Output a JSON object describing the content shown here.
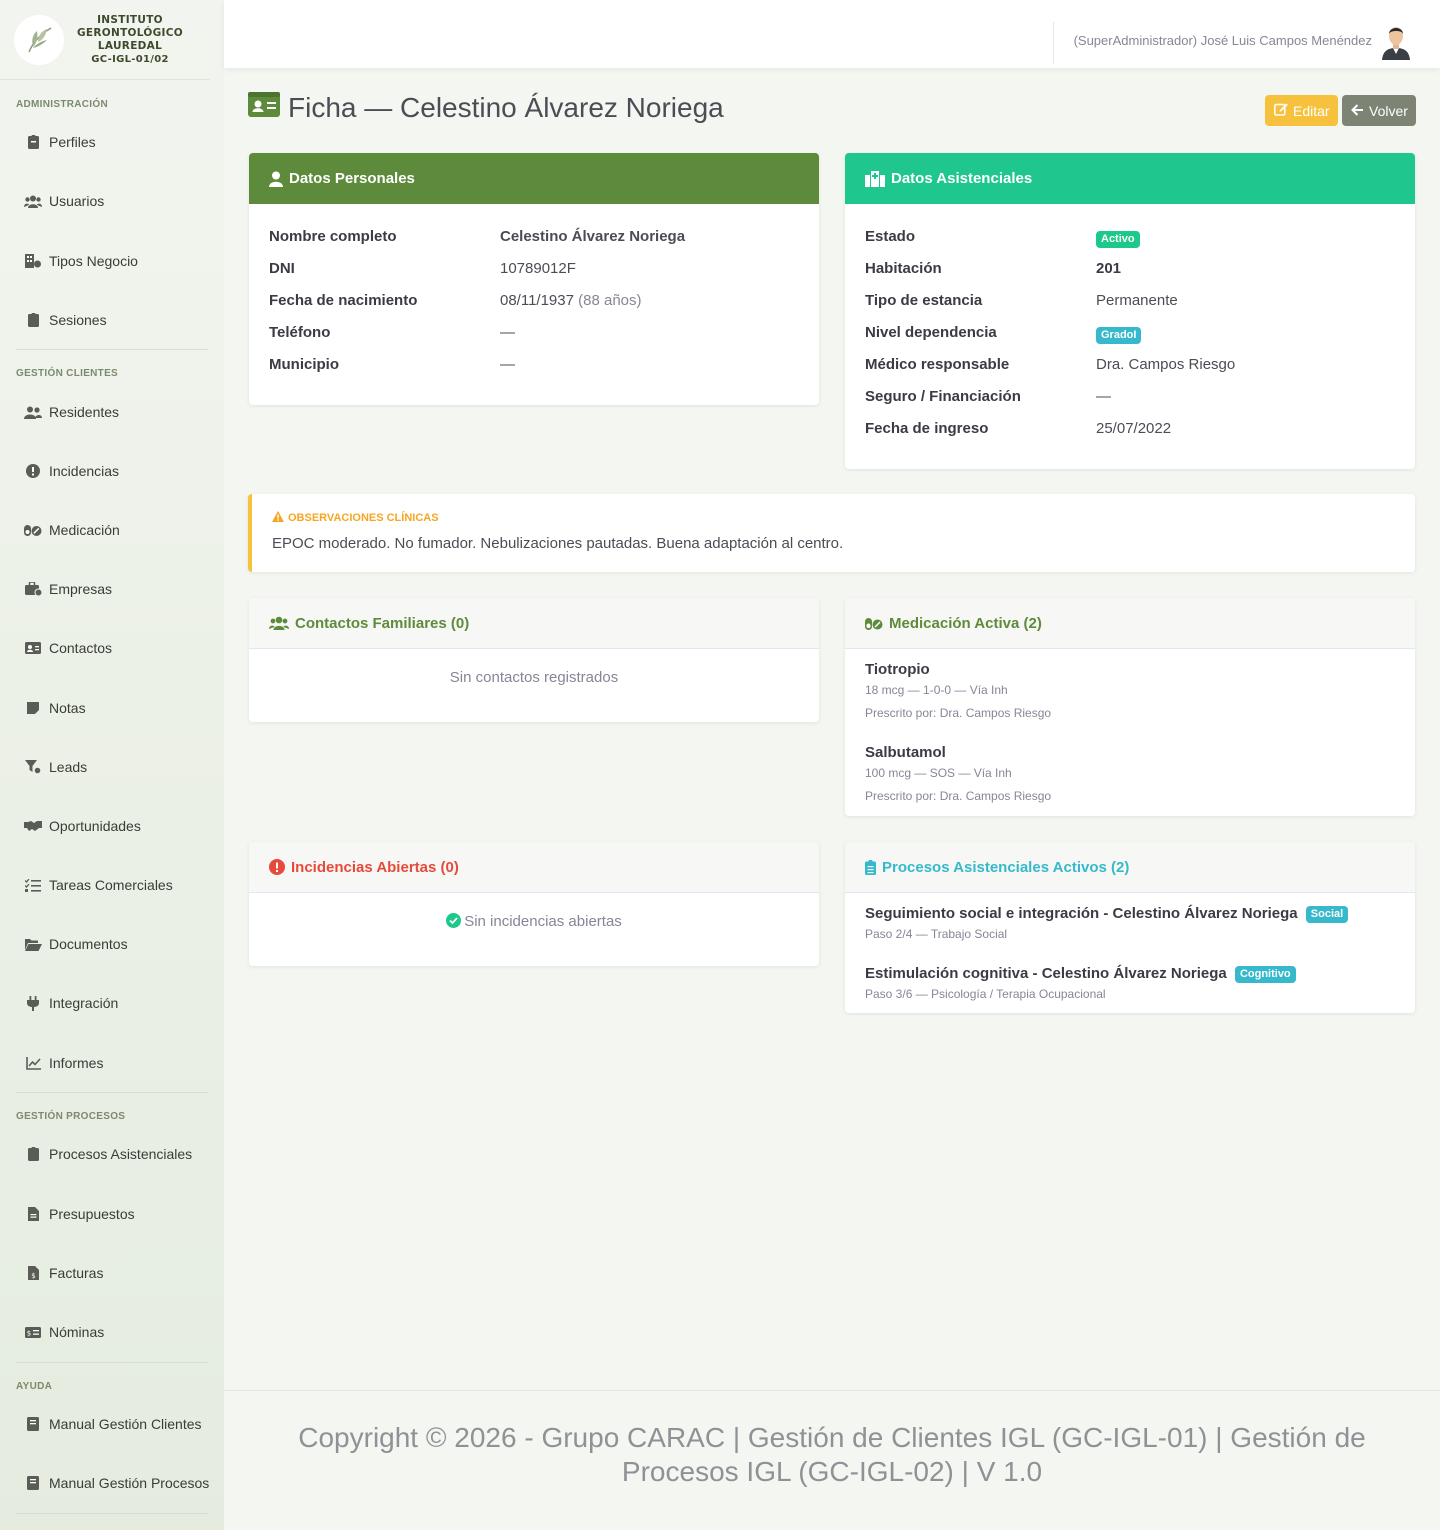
{
  "brand": {
    "line1": "INSTITUTO",
    "line2": "GERONTOLÓGICO",
    "line3": "LAUREDAL",
    "code": "GC-IGL-01/02"
  },
  "sidebar": {
    "sections": {
      "admin": "ADMINISTRACIÓN",
      "clientes": "GESTIÓN CLIENTES",
      "procesos": "GESTIÓN PROCESOS",
      "ayuda": "AYUDA"
    },
    "items": {
      "perfiles": "Perfiles",
      "usuarios": "Usuarios",
      "tipos_negocio": "Tipos Negocio",
      "sesiones": "Sesiones",
      "residentes": "Residentes",
      "incidencias": "Incidencias",
      "medicacion": "Medicación",
      "empresas": "Empresas",
      "contactos": "Contactos",
      "notas": "Notas",
      "leads": "Leads",
      "oportunidades": "Oportunidades",
      "tareas": "Tareas Comerciales",
      "documentos": "Documentos",
      "integracion": "Integración",
      "informes": "Informes",
      "procesos_asistenciales": "Procesos Asistenciales",
      "presupuestos": "Presupuestos",
      "facturas": "Facturas",
      "nominas": "Nóminas",
      "manual_clientes": "Manual Gestión Clientes",
      "manual_procesos": "Manual Gestión Procesos"
    }
  },
  "topbar": {
    "user": "(SuperAdministrador) José Luis Campos Menéndez"
  },
  "page": {
    "title": "Ficha — Celestino Álvarez Noriega",
    "edit_label": "Editar",
    "back_label": "Volver"
  },
  "personal": {
    "title": "Datos Personales",
    "fields": [
      {
        "label": "Nombre completo",
        "value": "Celestino Álvarez Noriega"
      },
      {
        "label": "DNI",
        "value": "10789012F"
      },
      {
        "label": "Fecha de nacimiento",
        "value": "08/11/1937",
        "extra": "(88 años)"
      },
      {
        "label": "Teléfono",
        "value": "—"
      },
      {
        "label": "Municipio",
        "value": "—"
      }
    ]
  },
  "asistencial": {
    "title": "Datos Asistenciales",
    "fields": [
      {
        "label": "Estado",
        "value": "Activo"
      },
      {
        "label": "Habitación",
        "value": "201"
      },
      {
        "label": "Tipo de estancia",
        "value": "Permanente"
      },
      {
        "label": "Nivel dependencia",
        "value": "GradoI"
      },
      {
        "label": "Médico responsable",
        "value": "Dra. Campos Riesgo"
      },
      {
        "label": "Seguro / Financiación",
        "value": "—"
      },
      {
        "label": "Fecha de ingreso",
        "value": "25/07/2022"
      }
    ]
  },
  "observaciones": {
    "title": "OBSERVACIONES CLÍNICAS",
    "text": "EPOC moderado. No fumador. Nebulizaciones pautadas. Buena adaptación al centro."
  },
  "contactos": {
    "title": "Contactos Familiares (0)",
    "empty": "Sin contactos registrados"
  },
  "medicacion": {
    "title": "Medicación Activa (2)",
    "items": [
      {
        "name": "Tiotropio",
        "detail": "18 mcg — 1-0-0 — Vía Inh",
        "prescriber": "Prescrito por: Dra. Campos Riesgo"
      },
      {
        "name": "Salbutamol",
        "detail": "100 mcg — SOS — Vía Inh",
        "prescriber": "Prescrito por: Dra. Campos Riesgo"
      }
    ]
  },
  "incidencias": {
    "title": "Incidencias Abiertas (0)",
    "empty": "Sin incidencias abiertas"
  },
  "procesos": {
    "title": "Procesos Asistenciales Activos (2)",
    "items": [
      {
        "name": "Seguimiento social e integración - Celestino Álvarez Noriega",
        "badge": "Social",
        "step": "Paso 2/4 — Trabajo Social"
      },
      {
        "name": "Estimulación cognitiva - Celestino Álvarez Noriega",
        "badge": "Cognitivo",
        "step": "Paso 3/6 — Psicología / Terapia Ocupacional"
      }
    ]
  },
  "footer": {
    "text": "Copyright © 2026 - Grupo CARAC | Gestión de Clientes IGL (GC-IGL-01) | Gestión de Procesos IGL (GC-IGL-02) | V 1.0"
  },
  "colors": {
    "primary_green": "#5e8b3b",
    "teal": "#1fc78e",
    "warning": "#f6c23e",
    "danger": "#e74a3b",
    "info": "#36b9cc"
  }
}
